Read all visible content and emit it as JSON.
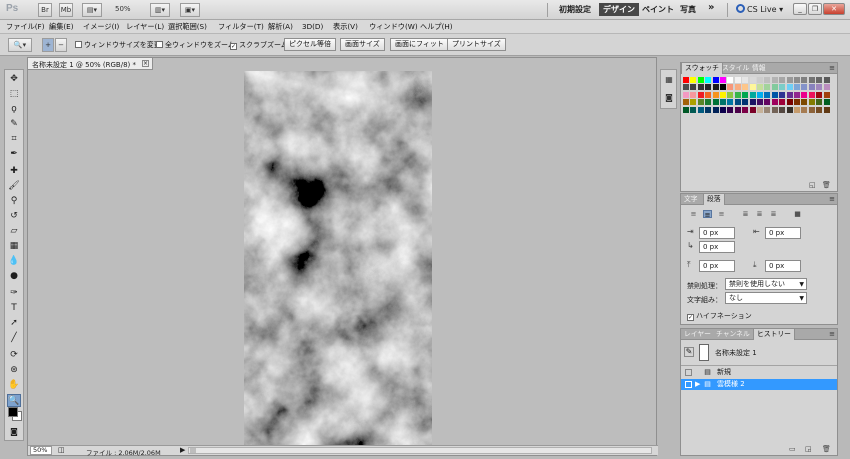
{
  "app": {
    "logo": "Ps",
    "zoom_display": "50%",
    "workspaces": [
      "初期設定",
      "デザイン",
      "ペイント",
      "写真"
    ],
    "active_workspace": "デザイン",
    "overflow": "»",
    "cs_live": "CS Live"
  },
  "menu": [
    "ファイル(F)",
    "編集(E)",
    "イメージ(I)",
    "レイヤー(L)",
    "選択範囲(S)",
    "フィルター(T)",
    "解析(A)",
    "3D(D)",
    "表示(V)",
    "ウィンドウ(W)",
    "ヘルプ(H)"
  ],
  "options": {
    "resize_windows": "ウィンドウサイズを変更",
    "resize_windows_checked": false,
    "all_windows": "全ウィンドウをズーム",
    "all_windows_checked": false,
    "scrubby_zoom": "スクラブズーム",
    "scrubby_zoom_checked": true,
    "actual_pixels": "ピクセル等倍",
    "fit_screen": "画面サイズ",
    "fill_screen": "画面にフィット",
    "print_size": "プリントサイズ"
  },
  "document": {
    "tab_title": "名称未設定 1 @ 50% (RGB/8) *",
    "status_zoom": "50%",
    "status_file": "ファイル : 2.06M/2.06M",
    "status_arrow": "▶"
  },
  "swatches_panel": {
    "tabs": [
      "スウォッチ",
      "スタイル",
      "情報"
    ],
    "active_tab": "スウォッチ",
    "colors": [
      "#ff0000",
      "#ffff00",
      "#00ff00",
      "#00ffff",
      "#0000ff",
      "#ff00ff",
      "#ffffff",
      "#f2f2f2",
      "#e6e6e6",
      "#d9d9d9",
      "#cccccc",
      "#bfbfbf",
      "#b3b3b3",
      "#a6a6a6",
      "#999999",
      "#8c8c8c",
      "#808080",
      "#737373",
      "#666666",
      "#595959",
      "#4d4d4d",
      "#404040",
      "#333333",
      "#262626",
      "#1a1a1a",
      "#000000",
      "#f7977a",
      "#f9ad81",
      "#fdc68a",
      "#fff79a",
      "#c4df9b",
      "#a2d39c",
      "#82ca9d",
      "#7bcdc8",
      "#6ecff6",
      "#7ea7d8",
      "#8493ca",
      "#8882be",
      "#a187be",
      "#bc8dbf",
      "#f49ac2",
      "#f6989d",
      "#ed1c24",
      "#f26522",
      "#f7941d",
      "#fff200",
      "#8dc63f",
      "#39b54a",
      "#00a651",
      "#00a99d",
      "#00aeef",
      "#0072bc",
      "#0054a6",
      "#2e3192",
      "#662d91",
      "#92278f",
      "#ec008c",
      "#ed145b",
      "#9e0b0f",
      "#a0410d",
      "#a3620a",
      "#aba000",
      "#598527",
      "#1a7b30",
      "#007236",
      "#00746b",
      "#0076a3",
      "#004a80",
      "#003471",
      "#1b1464",
      "#440e62",
      "#630460",
      "#9e005d",
      "#9e0039",
      "#790000",
      "#7b2e00",
      "#7d4900",
      "#827b00",
      "#406618",
      "#005e20",
      "#005826",
      "#005952",
      "#005b7f",
      "#003663",
      "#002157",
      "#0d004c",
      "#32004b",
      "#4b0049",
      "#7b0046",
      "#7a0026",
      "#c7b299",
      "#998675",
      "#736357",
      "#534741",
      "#37302a",
      "#c69c6d",
      "#a67c52",
      "#8c6239",
      "#754c24",
      "#603913"
    ]
  },
  "paragraph_panel": {
    "tabs": [
      "文字",
      "段落"
    ],
    "active_tab": "段落",
    "indent_left": "0 px",
    "indent_right": "0 px",
    "indent_first": "0 px",
    "space_before": "0 px",
    "space_after": "0 px",
    "kinsoku_label": "禁則処理：",
    "kinsoku_value": "禁則を使用しない",
    "mojikumi_label": "文字組み：",
    "mojikumi_value": "なし",
    "hyphenate_label": "ハイフネーション",
    "hyphenate_checked": true
  },
  "history_panel": {
    "tabs": [
      "レイヤー",
      "チャンネル",
      "ヒストリー"
    ],
    "active_tab": "ヒストリー",
    "snapshot": "名称未設定 1",
    "states": [
      {
        "label": "新規",
        "selected": false
      },
      {
        "label": "雲模様 2",
        "selected": true
      }
    ]
  }
}
